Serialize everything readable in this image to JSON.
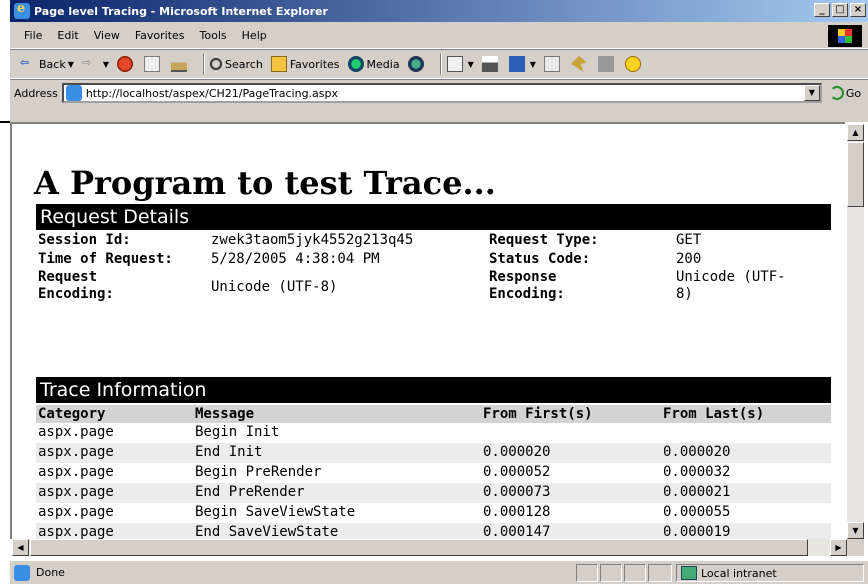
{
  "window": {
    "title": "Page level Tracing - Microsoft Internet Explorer",
    "buttons": [
      "_",
      "□",
      "×"
    ]
  },
  "menu": [
    "File",
    "Edit",
    "View",
    "Favorites",
    "Tools",
    "Help"
  ],
  "toolbar": {
    "back": "Back",
    "search": "Search",
    "favorites": "Favorites",
    "media": "Media"
  },
  "address": {
    "label": "Address",
    "url": "http://localhost/aspex/CH21/PageTracing.aspx",
    "go": "Go"
  },
  "page": {
    "heading": "A Program to test Trace...",
    "request_details": {
      "title": "Request Details",
      "session_id_label": "Session Id:",
      "session_id": "zwek3taom5jyk4552g213q45",
      "time_label": "Time of Request:",
      "time": "5/28/2005 4:38:04 PM",
      "req_enc_label_1": "Request",
      "req_enc_label_2": "Encoding:",
      "req_enc": "Unicode (UTF-8)",
      "req_type_label": "Request Type:",
      "req_type": "GET",
      "status_label": "Status Code:",
      "status": "200",
      "resp_enc_label_1": "Response",
      "resp_enc_label_2": "Encoding:",
      "resp_enc_1": "Unicode (UTF-",
      "resp_enc_2": "8)"
    },
    "trace": {
      "title": "Trace Information",
      "headers": [
        "Category",
        "Message",
        "From First(s)",
        "From Last(s)"
      ],
      "rows": [
        [
          "aspx.page",
          "Begin Init",
          "",
          ""
        ],
        [
          "aspx.page",
          "End Init",
          "0.000020",
          "0.000020"
        ],
        [
          "aspx.page",
          "Begin PreRender",
          "0.000052",
          "0.000032"
        ],
        [
          "aspx.page",
          "End PreRender",
          "0.000073",
          "0.000021"
        ],
        [
          "aspx.page",
          "Begin SaveViewState",
          "0.000128",
          "0.000055"
        ],
        [
          "aspx.page",
          "End SaveViewState",
          "0.000147",
          "0.000019"
        ]
      ]
    }
  },
  "status": {
    "text": "Done",
    "zone": "Local intranet"
  }
}
